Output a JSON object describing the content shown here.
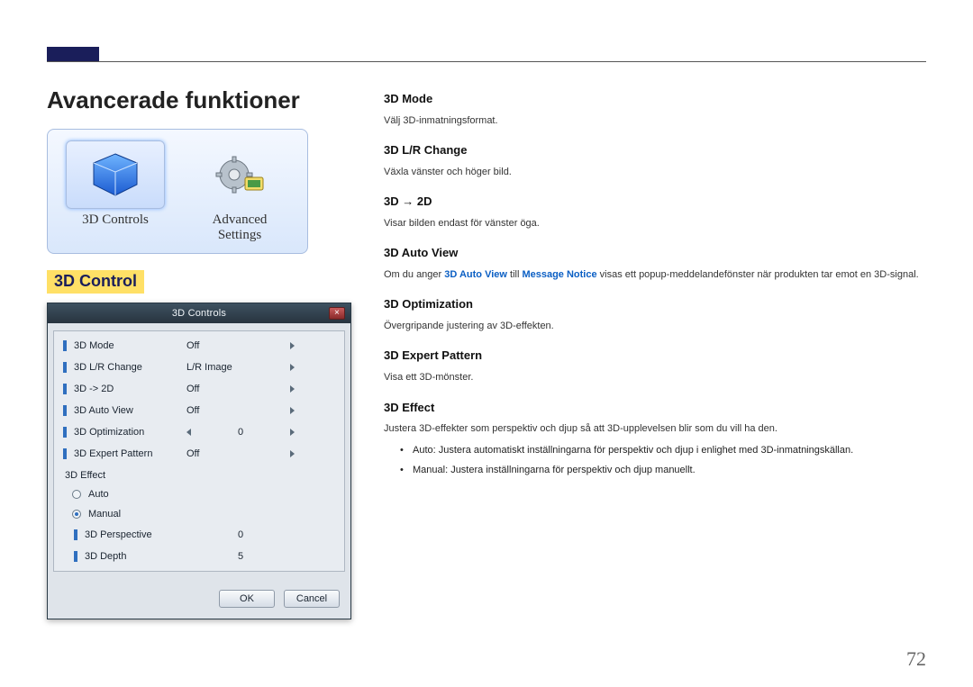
{
  "page_number": "72",
  "title": "Avancerade funktioner",
  "thumbs": {
    "controls_label": "3D Controls",
    "advanced_label_line1": "Advanced",
    "advanced_label_line2": "Settings"
  },
  "section_heading": "3D Control",
  "dialog": {
    "title": "3D Controls",
    "close_glyph": "×",
    "rows": [
      {
        "label": "3D Mode",
        "value": "Off"
      },
      {
        "label": "3D L/R Change",
        "value": "L/R Image"
      },
      {
        "label": "3D -> 2D",
        "value": "Off"
      },
      {
        "label": "3D Auto View",
        "value": "Off"
      },
      {
        "label": "3D Optimization",
        "value": "0"
      },
      {
        "label": "3D Expert Pattern",
        "value": "Off"
      }
    ],
    "effect_group": "3D Effect",
    "radios": {
      "auto": "Auto",
      "manual": "Manual",
      "selected": "manual"
    },
    "subrows": [
      {
        "label": "3D Perspective",
        "value": "0"
      },
      {
        "label": "3D Depth",
        "value": "5"
      }
    ],
    "ok": "OK",
    "cancel": "Cancel"
  },
  "right": {
    "items": [
      {
        "h": "3D Mode",
        "d": "Välj 3D-inmatningsformat."
      },
      {
        "h": "3D L/R Change",
        "d": "Växla vänster och höger bild."
      },
      {
        "h": "3D → 2D",
        "d": "Visar bilden endast för vänster öga."
      },
      {
        "h": "3D Auto View",
        "pre": "Om du anger ",
        "kw1": "3D Auto View",
        "mid": " till ",
        "kw2": "Message Notice",
        "post": " visas ett popup-meddelandefönster när produkten tar emot en 3D-signal."
      },
      {
        "h": "3D Optimization",
        "d": "Övergripande justering av 3D-effekten."
      },
      {
        "h": "3D Expert Pattern",
        "d": "Visa ett 3D-mönster."
      },
      {
        "h": "3D Effect",
        "d": "Justera 3D-effekter som perspektiv och djup så att 3D-upplevelsen blir som du vill ha den.",
        "bullets": [
          {
            "kw": "Auto",
            "txt": ": Justera automatiskt inställningarna för perspektiv och djup i enlighet med 3D-inmatningskällan."
          },
          {
            "kw": "Manual",
            "txt": ": Justera inställningarna för perspektiv och djup manuellt."
          }
        ]
      }
    ]
  }
}
